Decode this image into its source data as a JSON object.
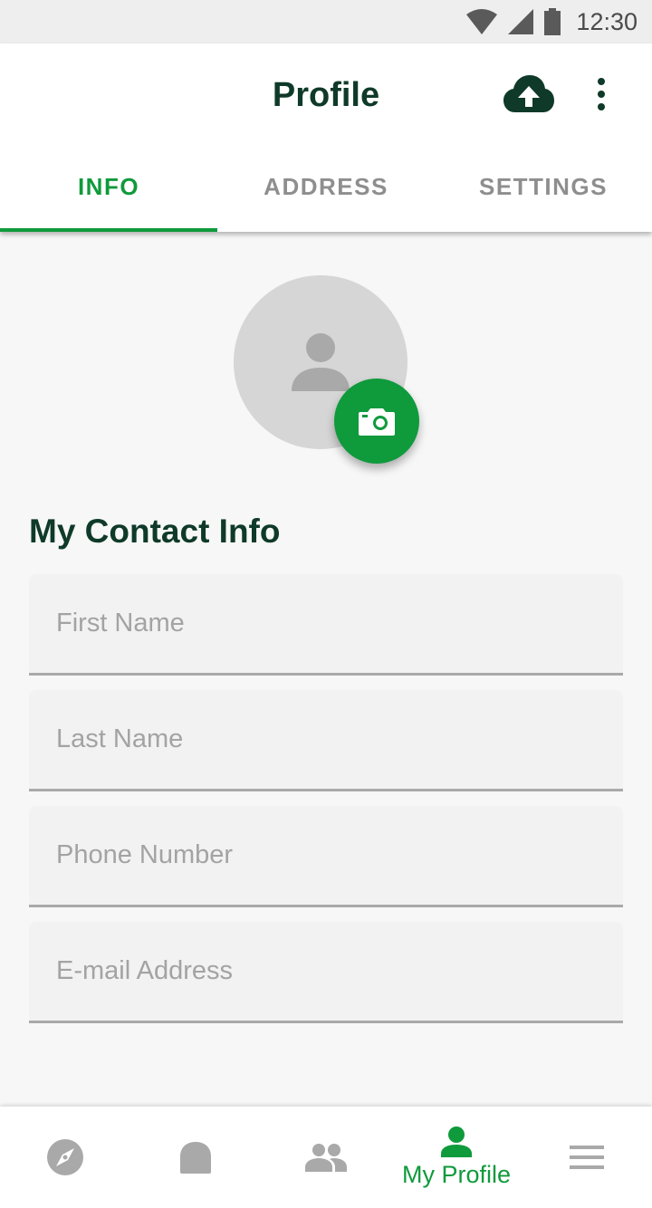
{
  "status_bar": {
    "time": "12:30",
    "icons": [
      "wifi-icon",
      "signal-icon",
      "battery-icon"
    ]
  },
  "header": {
    "title": "Profile",
    "actions": [
      "cloud-upload-icon",
      "more-vert-icon"
    ]
  },
  "tabs": [
    {
      "label": "INFO",
      "active": true
    },
    {
      "label": "ADDRESS",
      "active": false
    },
    {
      "label": "SETTINGS",
      "active": false
    }
  ],
  "avatar": {
    "icon": "person-icon",
    "action_icon": "camera-icon"
  },
  "contact": {
    "title": "My Contact Info",
    "fields": [
      {
        "placeholder": "First Name",
        "value": ""
      },
      {
        "placeholder": "Last Name",
        "value": ""
      },
      {
        "placeholder": "Phone Number",
        "value": ""
      },
      {
        "placeholder": "E-mail Address",
        "value": ""
      }
    ]
  },
  "bottom_nav": {
    "items": [
      {
        "icon": "compass-icon",
        "label": "",
        "active": false
      },
      {
        "icon": "lock-icon",
        "label": "",
        "active": false
      },
      {
        "icon": "people-icon",
        "label": "",
        "active": false
      },
      {
        "icon": "person-icon",
        "label": "My Profile",
        "active": true
      },
      {
        "icon": "menu-icon",
        "label": "",
        "active": false
      }
    ]
  },
  "colors": {
    "accent": "#0f9a3c",
    "title": "#0f3a29",
    "inactive": "#8e8e8e"
  }
}
